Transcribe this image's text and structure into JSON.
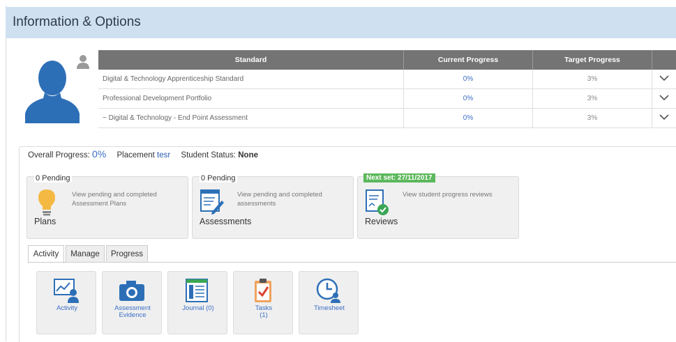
{
  "header": {
    "title": "Information & Options"
  },
  "standards_table": {
    "columns": [
      "Standard",
      "Current Progress",
      "Target Progress"
    ],
    "rows": [
      {
        "standard": "Digital & Technology Apprenticeship Standard",
        "current": "0%",
        "target": "3%"
      },
      {
        "standard": "Professional Development Portfolio",
        "current": "0%",
        "target": "3%"
      },
      {
        "standard": "~ Digital & Technology - End Point Assessment",
        "current": "0%",
        "target": "3%"
      }
    ]
  },
  "summary": {
    "overall_label": "Overall Progress:",
    "overall_value": "0%",
    "placement_label": "Placement",
    "placement_value": "tesr",
    "status_label": "Student Status:",
    "status_value": "None"
  },
  "cards": {
    "plans": {
      "pending": "0 Pending",
      "desc": "View pending and completed Assessment Plans",
      "title": "Plans"
    },
    "assessments": {
      "pending": "0 Pending",
      "desc": "View pending and completed assessments",
      "title": "Assessments"
    },
    "reviews": {
      "badge": "Next set: 27/11/2017",
      "desc": "View student progress reviews",
      "title": "Reviews"
    }
  },
  "tabs": [
    "Activity",
    "Manage",
    "Progress"
  ],
  "tiles": [
    "Activity",
    "Assessment\nEvidence",
    "Journal (0)",
    "Tasks\n(1)",
    "Timesheet"
  ],
  "colors": {
    "header_bg": "#cfe0f1",
    "accent_blue": "#2d6fb7",
    "link_blue": "#3b6fc6",
    "badge_green": "#5cb85c",
    "table_header": "#747474"
  },
  "icons": [
    "user-silhouette-icon",
    "user-small-icon",
    "chevron-down-icon",
    "lightbulb-icon",
    "assessment-icon",
    "reviews-check-icon",
    "activity-chart-icon",
    "camera-icon",
    "journal-grid-icon",
    "tasks-clipboard-icon",
    "clock-user-icon"
  ]
}
